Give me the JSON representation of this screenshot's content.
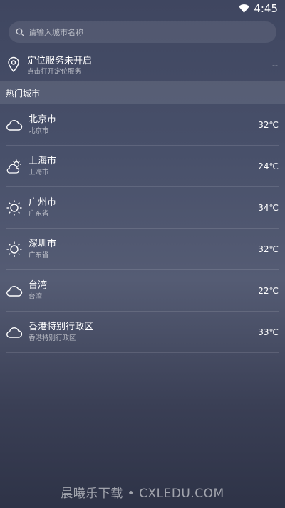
{
  "status_bar": {
    "time": "4:45"
  },
  "search": {
    "placeholder": "请输入城市名称"
  },
  "location": {
    "title": "定位服务未开启",
    "subtitle": "点击打开定位服务",
    "value": "--"
  },
  "hot_cities": {
    "header": "热门城市",
    "cities": [
      {
        "name": "北京市",
        "region": "北京市",
        "temp": "32℃",
        "icon": "cloudy-icon"
      },
      {
        "name": "上海市",
        "region": "上海市",
        "temp": "24℃",
        "icon": "partly-cloudy-icon"
      },
      {
        "name": "广州市",
        "region": "广东省",
        "temp": "34℃",
        "icon": "sunny-icon"
      },
      {
        "name": "深圳市",
        "region": "广东省",
        "temp": "32℃",
        "icon": "sunny-icon"
      },
      {
        "name": "台湾",
        "region": "台湾",
        "temp": "22℃",
        "icon": "cloudy-icon"
      },
      {
        "name": "香港特别行政区",
        "region": "香港特别行政区",
        "temp": "33℃",
        "icon": "cloudy-icon"
      }
    ]
  },
  "watermark": "晨曦乐下载 • CXLEDU.COM"
}
